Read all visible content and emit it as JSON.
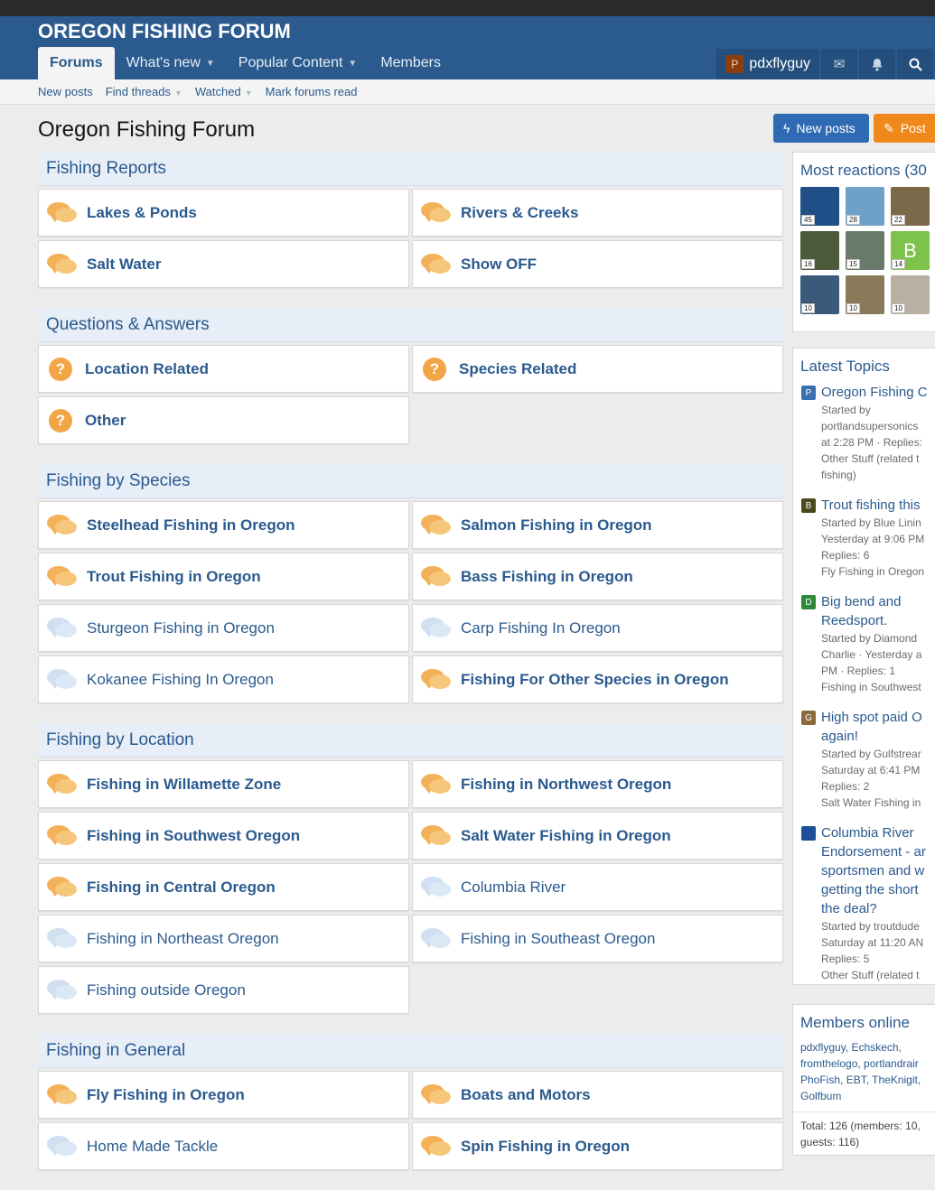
{
  "site": {
    "logo": "OREGON FISHING FORUM"
  },
  "nav": {
    "tabs": [
      {
        "label": "Forums",
        "active": true
      },
      {
        "label": "What's new",
        "dropdown": true
      },
      {
        "label": "Popular Content",
        "dropdown": true
      },
      {
        "label": "Members"
      }
    ],
    "user": {
      "avatar_letter": "P",
      "name": "pdxflyguy"
    }
  },
  "subnav": [
    "New posts",
    "Find threads",
    "Watched",
    "Mark forums read"
  ],
  "page": {
    "title": "Oregon Fishing Forum",
    "new_posts_button": "New posts",
    "post_button": "Post"
  },
  "categories": [
    {
      "title": "Fishing Reports",
      "type": "bubble",
      "nodes": [
        {
          "label": "Lakes & Ponds",
          "unread": true
        },
        {
          "label": "Rivers & Creeks",
          "unread": true
        },
        {
          "label": "Salt Water",
          "unread": true
        },
        {
          "label": "Show OFF",
          "unread": true
        }
      ]
    },
    {
      "title": "Questions & Answers",
      "type": "question",
      "nodes": [
        {
          "label": "Location Related",
          "unread": true
        },
        {
          "label": "Species Related",
          "unread": true
        },
        {
          "label": "Other",
          "unread": true
        }
      ]
    },
    {
      "title": "Fishing by Species",
      "type": "bubble",
      "nodes": [
        {
          "label": "Steelhead Fishing in Oregon",
          "unread": true
        },
        {
          "label": "Salmon Fishing in Oregon",
          "unread": true
        },
        {
          "label": "Trout Fishing in Oregon",
          "unread": true
        },
        {
          "label": "Bass Fishing in Oregon",
          "unread": true
        },
        {
          "label": "Sturgeon Fishing in Oregon",
          "unread": false
        },
        {
          "label": "Carp Fishing In Oregon",
          "unread": false
        },
        {
          "label": "Kokanee Fishing In Oregon",
          "unread": false
        },
        {
          "label": "Fishing For Other Species in Oregon",
          "unread": true
        }
      ]
    },
    {
      "title": "Fishing by Location",
      "type": "bubble",
      "nodes": [
        {
          "label": "Fishing in Willamette Zone",
          "unread": true
        },
        {
          "label": "Fishing in Northwest Oregon",
          "unread": true
        },
        {
          "label": "Fishing in Southwest Oregon",
          "unread": true
        },
        {
          "label": "Salt Water Fishing in Oregon",
          "unread": true
        },
        {
          "label": "Fishing in Central Oregon",
          "unread": true
        },
        {
          "label": "Columbia River",
          "unread": false
        },
        {
          "label": "Fishing in Northeast Oregon",
          "unread": false
        },
        {
          "label": "Fishing in Southeast Oregon",
          "unread": false
        },
        {
          "label": "Fishing outside Oregon",
          "unread": false
        }
      ]
    },
    {
      "title": "Fishing in General",
      "type": "bubble",
      "nodes": [
        {
          "label": "Fly Fishing in Oregon",
          "unread": true
        },
        {
          "label": "Boats and Motors",
          "unread": true
        },
        {
          "label": "Home Made Tackle",
          "unread": false
        },
        {
          "label": "Spin Fishing in Oregon",
          "unread": true
        }
      ]
    }
  ],
  "sidebar": {
    "reactions": {
      "title": "Most reactions (30",
      "avatars": [
        {
          "count": "45",
          "color": "#1f4f86"
        },
        {
          "count": "28",
          "color": "#6fa0c8"
        },
        {
          "count": "22",
          "color": "#7a6a4a"
        },
        {
          "count": "16",
          "color": "#4a5a3a"
        },
        {
          "count": "15",
          "color": "#6a7a6a"
        },
        {
          "count": "14",
          "color": "#7dc24a",
          "letter": "B"
        },
        {
          "count": "10",
          "color": "#3a5a7a"
        },
        {
          "count": "10",
          "color": "#8a7a5a"
        },
        {
          "count": "10",
          "color": "#b8b0a0"
        }
      ]
    },
    "latest": {
      "title": "Latest Topics",
      "topics": [
        {
          "letter": "P",
          "color": "#3b6fb0",
          "title": "Oregon Fishing C",
          "meta": [
            "Started by",
            "portlandsupersonics",
            "at 2:28 PM · Replies:",
            "Other Stuff (related t",
            "fishing)"
          ]
        },
        {
          "letter": "B",
          "color": "#4a4a1a",
          "title": "Trout fishing this",
          "meta": [
            "Started by Blue Linin",
            "Yesterday at 9:06 PM",
            "Replies: 6",
            "Fly Fishing in Oregon"
          ]
        },
        {
          "letter": "D",
          "color": "#2e8a3a",
          "title": "Big bend and Reedsport.",
          "meta": [
            "Started by Diamond",
            "Charlie · Yesterday a",
            "PM · Replies: 1",
            "Fishing in Southwest"
          ]
        },
        {
          "letter": "G",
          "color": "#8a6a3a",
          "title": "High spot paid O again!",
          "meta": [
            "Started by Gulfstrear",
            "Saturday at 6:41 PM",
            "Replies: 2",
            "Salt Water Fishing in"
          ]
        },
        {
          "letter": "",
          "color": "#1e4f9a",
          "title": "Columbia River Endorsement - ar sportsmen and w getting the short the deal?",
          "meta": [
            "Started by troutdude",
            "Saturday at 11:20 AN",
            "Replies: 5",
            "Other Stuff (related t",
            "fishing)"
          ]
        }
      ]
    },
    "online": {
      "title": "Members online",
      "names": "pdxflyguy, Echskech, fromthelogo, portlandrair PhoFish, EBT, TheKnigit, Golfbum",
      "total": "Total: 126 (members: 10, guests: 116)"
    }
  }
}
